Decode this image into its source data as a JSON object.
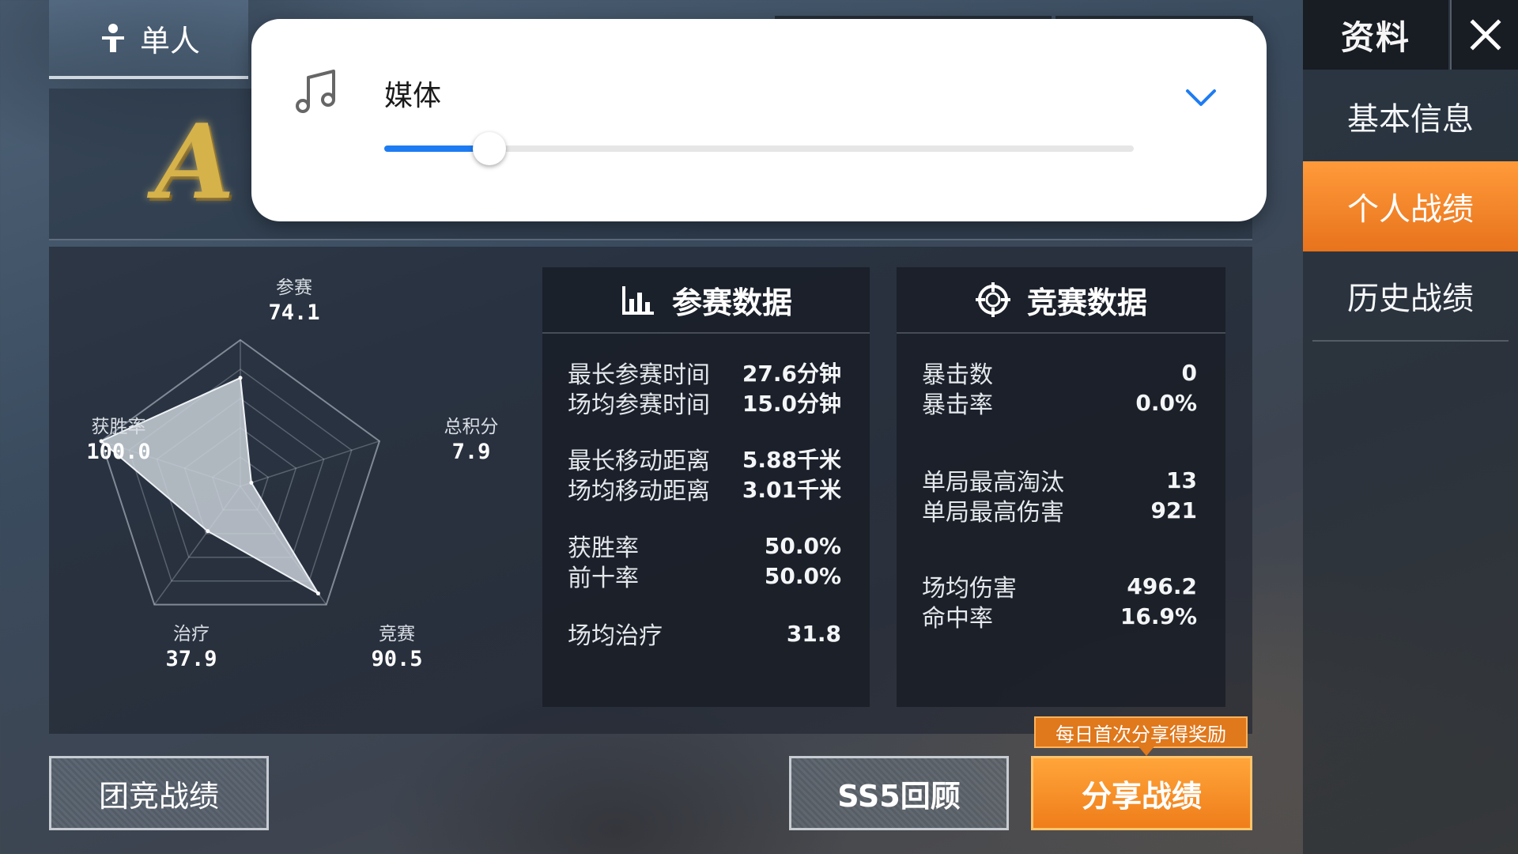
{
  "mode_tab": {
    "label": "单人",
    "icon": "person-icon"
  },
  "rank": {
    "letter": "A"
  },
  "radar": {
    "axes": [
      {
        "name": "参赛",
        "value": "74.1",
        "v": 74.1
      },
      {
        "name": "总积分",
        "value": "7.9",
        "v": 7.9
      },
      {
        "name": "竞赛",
        "value": "90.5",
        "v": 90.5
      },
      {
        "name": "治疗",
        "value": "37.9",
        "v": 37.9
      },
      {
        "name": "获胜率",
        "value": "100.0",
        "v": 100.0
      }
    ],
    "max": 100
  },
  "participation": {
    "title": "参赛数据",
    "icon": "bar-chart-icon",
    "rows": [
      {
        "label": "最长参赛时间",
        "value": "27.6分钟"
      },
      {
        "label": "场均参赛时间",
        "value": "15.0分钟"
      },
      {
        "label": "最长移动距离",
        "value": "5.88千米"
      },
      {
        "label": "场均移动距离",
        "value": "3.01千米"
      },
      {
        "label": "获胜率",
        "value": "50.0%"
      },
      {
        "label": "前十率",
        "value": "50.0%"
      },
      {
        "label": "场均治疗",
        "value": "31.8"
      }
    ]
  },
  "competition": {
    "title": "竞赛数据",
    "icon": "crosshair-icon",
    "rows": [
      {
        "label": "暴击数",
        "value": "0"
      },
      {
        "label": "暴击率",
        "value": "0.0%"
      },
      {
        "label": "单局最高淘汰",
        "value": "13"
      },
      {
        "label": "单局最高伤害",
        "value": "921"
      },
      {
        "label": "场均伤害",
        "value": "496.2"
      },
      {
        "label": "命中率",
        "value": "16.9%"
      }
    ]
  },
  "side_menu": {
    "title": "资料",
    "items": [
      {
        "label": "基本信息"
      },
      {
        "label": "个人战绩"
      },
      {
        "label": "历史战绩"
      }
    ],
    "active_index": 1
  },
  "buttons": {
    "team_stats": "团竞战绩",
    "season_review": "SS5回顾",
    "share": "分享战绩",
    "share_tip": "每日首次分享得奖励"
  },
  "volume_popup": {
    "label": "媒体",
    "icon": "music-note-icon",
    "level_percent": 14,
    "accent": "#1e7cf2"
  }
}
